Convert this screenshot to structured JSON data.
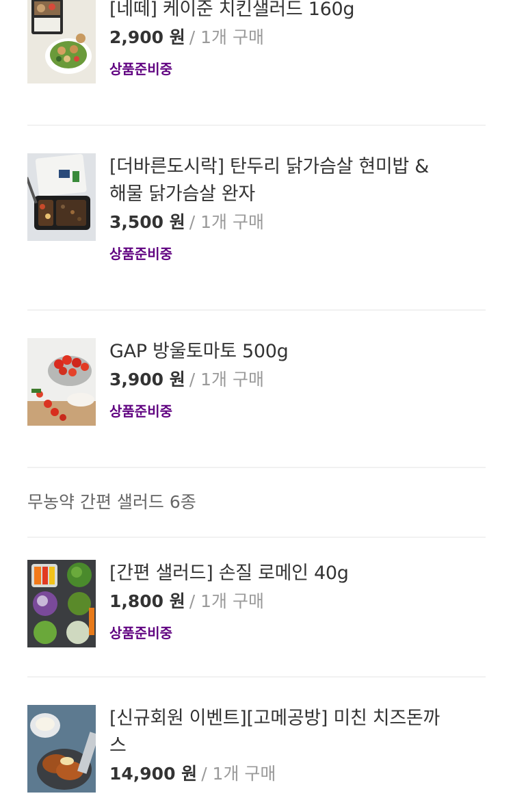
{
  "products": [
    {
      "name": "[네떼] 케이준 치킨샐러드 160g",
      "price": "2,900 원",
      "qty": "/ 1개 구매",
      "status": "상품준비중"
    },
    {
      "name_line1": "[더바른도시락] 탄두리 닭가슴살 현미밥 &",
      "name_line2": "해물 닭가슴살 완자",
      "price": "3,500 원",
      "qty": "/ 1개 구매",
      "status": "상품준비중"
    },
    {
      "name": "GAP 방울토마토 500g",
      "price": "3,900 원",
      "qty": "/ 1개 구매",
      "status": "상품준비중"
    },
    {
      "name": "[간편 샐러드] 손질 로메인 40g",
      "price": "1,800 원",
      "qty": "/ 1개 구매",
      "status": "상품준비중"
    },
    {
      "name_line1": "[신규회원 이벤트][고메공방] 미친 치즈돈까",
      "name_line2": "스",
      "price": "14,900 원",
      "qty": "/ 1개 구매"
    }
  ],
  "section": {
    "label": "무농약 간편 샐러드 6종"
  },
  "colors": {
    "status": "#5f0080",
    "name": "#333333",
    "qty": "#999999",
    "divider": "#f1f1f1"
  }
}
